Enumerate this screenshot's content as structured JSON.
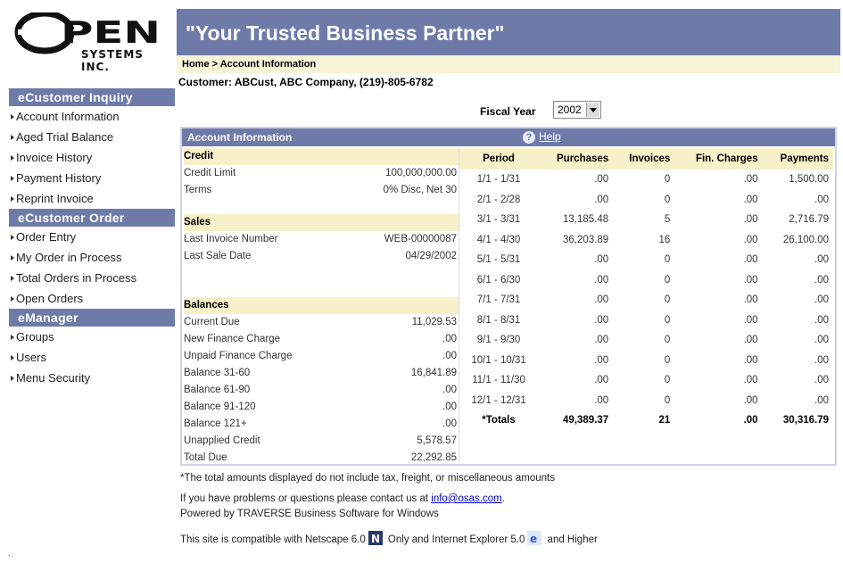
{
  "logo": {
    "text": "OPEN",
    "subtext": "SYSTEMS INC."
  },
  "banner": {
    "title": "\"Your Trusted Business Partner\""
  },
  "breadcrumb": "Home > Account Information",
  "customer": "Customer: ABCust, ABC Company, (219)-805-6782",
  "fiscal_year": {
    "label": "Fiscal Year",
    "value": "2002"
  },
  "sidebar": {
    "sections": [
      {
        "title": "eCustomer Inquiry",
        "items": [
          "Account Information",
          "Aged Trial Balance",
          "Invoice History",
          "Payment History",
          "Reprint Invoice"
        ]
      },
      {
        "title": "eCustomer Order",
        "items": [
          "Order Entry",
          "My Order in Process",
          "Total Orders in Process",
          "Open Orders"
        ]
      },
      {
        "title": "eManager",
        "items": [
          "Groups",
          "Users",
          "Menu Security"
        ]
      }
    ]
  },
  "panel": {
    "title": "Account Information",
    "help": "Help"
  },
  "credit": {
    "heading": "Credit",
    "rows": [
      {
        "label": "Credit Limit",
        "value": "100,000,000.00"
      },
      {
        "label": "Terms",
        "value": "0% Disc, Net 30"
      }
    ]
  },
  "sales": {
    "heading": "Sales",
    "rows": [
      {
        "label": "Last Invoice Number",
        "value": "WEB-00000087"
      },
      {
        "label": "Last Sale Date",
        "value": "04/29/2002"
      }
    ]
  },
  "balances": {
    "heading": "Balances",
    "rows": [
      {
        "label": "Current Due",
        "value": "11,029.53"
      },
      {
        "label": "New Finance Charge",
        "value": ".00"
      },
      {
        "label": "Unpaid Finance Charge",
        "value": ".00"
      },
      {
        "label": "Balance 31-60",
        "value": "16,841.89"
      },
      {
        "label": "Balance 61-90",
        "value": ".00"
      },
      {
        "label": "Balance 91-120",
        "value": ".00"
      },
      {
        "label": "Balance 121+",
        "value": ".00"
      },
      {
        "label": "Unapplied Credit",
        "value": "5,578.57"
      },
      {
        "label": "Total Due",
        "value": "22,292.85"
      }
    ]
  },
  "periods": {
    "headers": [
      "Period",
      "Purchases",
      "Invoices",
      "Fin. Charges",
      "Payments"
    ],
    "rows": [
      [
        "1/1 - 1/31",
        ".00",
        "0",
        ".00",
        "1,500.00"
      ],
      [
        "2/1 - 2/28",
        ".00",
        "0",
        ".00",
        ".00"
      ],
      [
        "3/1 - 3/31",
        "13,185.48",
        "5",
        ".00",
        "2,716.79"
      ],
      [
        "4/1 - 4/30",
        "36,203.89",
        "16",
        ".00",
        "26,100.00"
      ],
      [
        "5/1 - 5/31",
        ".00",
        "0",
        ".00",
        ".00"
      ],
      [
        "6/1 - 6/30",
        ".00",
        "0",
        ".00",
        ".00"
      ],
      [
        "7/1 - 7/31",
        ".00",
        "0",
        ".00",
        ".00"
      ],
      [
        "8/1 - 8/31",
        ".00",
        "0",
        ".00",
        ".00"
      ],
      [
        "9/1 - 9/30",
        ".00",
        "0",
        ".00",
        ".00"
      ],
      [
        "10/1 - 10/31",
        ".00",
        "0",
        ".00",
        ".00"
      ],
      [
        "11/1 - 11/30",
        ".00",
        "0",
        ".00",
        ".00"
      ],
      [
        "12/1 - 12/31",
        ".00",
        "0",
        ".00",
        ".00"
      ]
    ],
    "totals": [
      "*Totals",
      "49,389.37",
      "21",
      ".00",
      "30,316.79"
    ]
  },
  "footer": {
    "note": "*The total amounts displayed do not include tax, freight, or miscellaneous amounts",
    "contact_prefix": "If you have problems or questions please contact us at ",
    "contact_email": "info@osas.com",
    "contact_suffix": ".",
    "powered": "Powered by TRAVERSE Business Software for Windows",
    "compat_prefix": "This site is compatible with Netscape 6.0",
    "compat_mid": " Only and Internet Explorer 5.0",
    "compat_suffix": " and Higher"
  }
}
